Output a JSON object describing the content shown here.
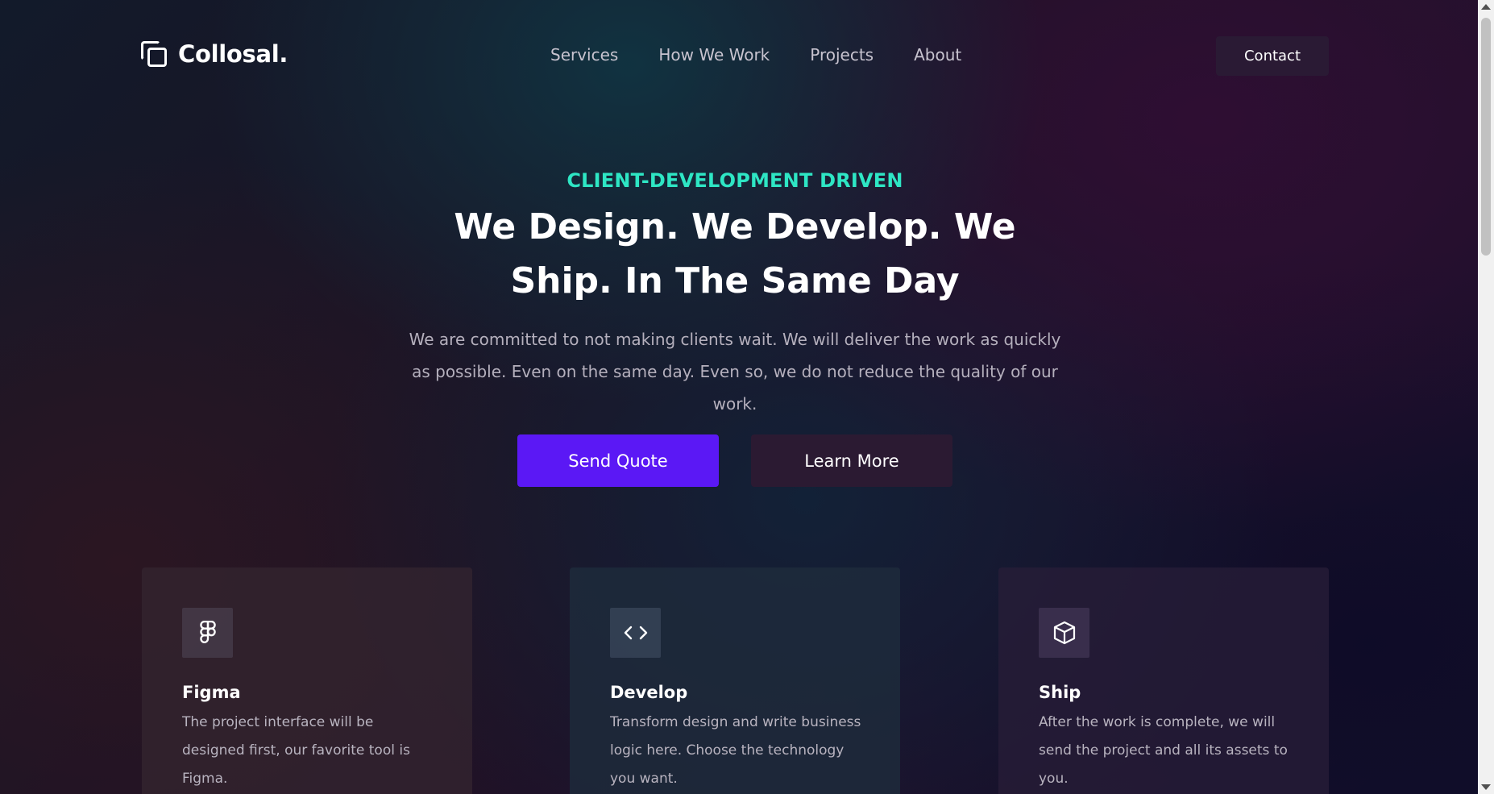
{
  "brand": {
    "name": "Collosal.",
    "icon": "copy-squares-icon"
  },
  "nav": {
    "items": [
      {
        "label": "Services"
      },
      {
        "label": "How We Work"
      },
      {
        "label": "Projects"
      },
      {
        "label": "About"
      }
    ],
    "contact_label": "Contact"
  },
  "hero": {
    "eyebrow": "CLIENT-DEVELOPMENT DRIVEN",
    "headline": "We Design. We Develop. We Ship. In The Same Day",
    "subtitle": "We are committed to not making clients wait. We will deliver the work as quickly as possible. Even on the same day. Even so, we do not reduce the quality of our work.",
    "primary_button": "Send Quote",
    "secondary_button": "Learn More"
  },
  "cards": [
    {
      "icon": "figma-icon",
      "title": "Figma",
      "text": "The project interface will be designed first, our favorite tool is Figma."
    },
    {
      "icon": "code-icon",
      "title": "Develop",
      "text": "Transform design and write business logic here. Choose the technology you want."
    },
    {
      "icon": "box-icon",
      "title": "Ship",
      "text": "After the work is complete, we will send the project and all its assets to you."
    }
  ],
  "colors": {
    "accent": "#2ee6c4",
    "primary_button": "#5b18f5",
    "secondary_button": "#2b1a32"
  }
}
